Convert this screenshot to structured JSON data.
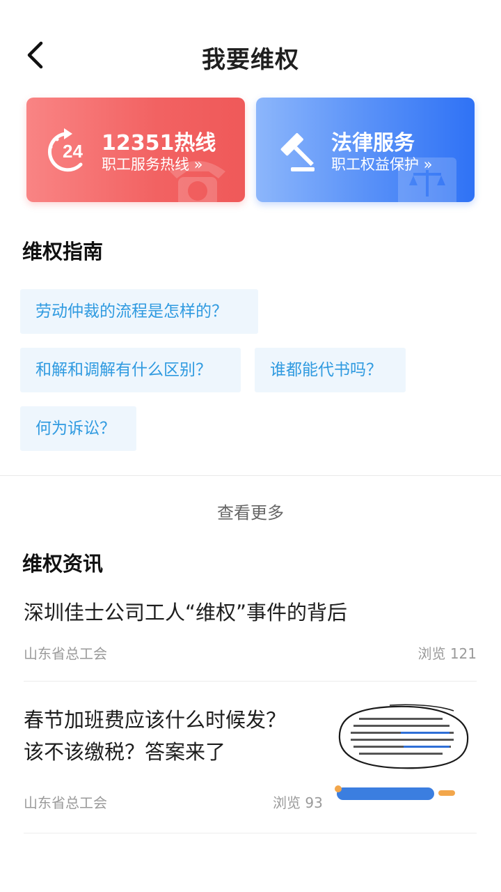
{
  "header": {
    "title": "我要维权"
  },
  "cards": [
    {
      "title": "12351热线",
      "subtitle": "职工服务热线 »",
      "color": "#f26262",
      "icon": "hotline-24-icon"
    },
    {
      "title": "法律服务",
      "subtitle": "职工权益保护 »",
      "color": "#3f7ff6",
      "icon": "gavel-icon"
    }
  ],
  "guide": {
    "title": "维权指南",
    "tags": [
      "劳动仲裁的流程是怎样的？",
      "和解和调解有什么区别？",
      "谁都能代书吗？",
      "何为诉讼？"
    ],
    "more_label": "查看更多"
  },
  "news": {
    "title": "维权资讯",
    "items": [
      {
        "title": "深圳佳士公司工人“维权”事件的背后",
        "source": "山东省总工会",
        "views": "浏览 121"
      },
      {
        "title_line1": "春节加班费应该什么时候发？",
        "title_line2": "该不该缴税？答案来了",
        "source": "山东省总工会",
        "views": "浏览 93"
      }
    ]
  },
  "colors": {
    "tag_bg": "#eef6fd",
    "tag_text": "#2f9ae0",
    "accent_red": "#f26262",
    "accent_blue": "#3f7ff6"
  }
}
